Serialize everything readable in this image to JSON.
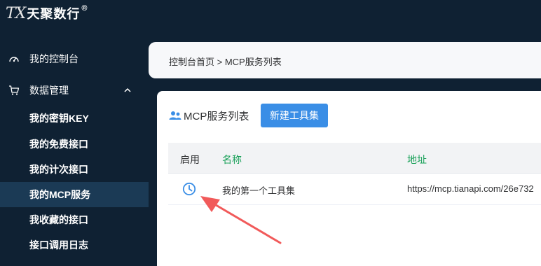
{
  "brand": {
    "mark": "TX",
    "name": "天聚数行",
    "reg": "®"
  },
  "sidebar": {
    "top_items": [
      {
        "label": "我的控制台",
        "icon": "dashboard-icon"
      },
      {
        "label": "数据管理",
        "icon": "cart-icon",
        "expanded": true
      }
    ],
    "sub_items": [
      {
        "label": "我的密钥KEY",
        "active": false
      },
      {
        "label": "我的免费接口",
        "active": false
      },
      {
        "label": "我的计次接口",
        "active": false
      },
      {
        "label": "我的MCP服务",
        "active": true
      },
      {
        "label": "我收藏的接口",
        "active": false
      },
      {
        "label": "接口调用日志",
        "active": false
      }
    ]
  },
  "breadcrumb": {
    "text": "控制台首页 > MCP服务列表"
  },
  "panel": {
    "title": "MCP服务列表",
    "new_button": "新建工具集"
  },
  "table": {
    "columns": [
      "启用",
      "名称",
      "地址"
    ],
    "rows": [
      {
        "name": "我的第一个工具集",
        "address": "https://mcp.tianapi.com/26e732"
      }
    ]
  },
  "colors": {
    "sidebar_bg": "#0f2133",
    "accent": "#3a8ee6",
    "header_green": "#18a058",
    "arrow": "#f15a5a"
  }
}
